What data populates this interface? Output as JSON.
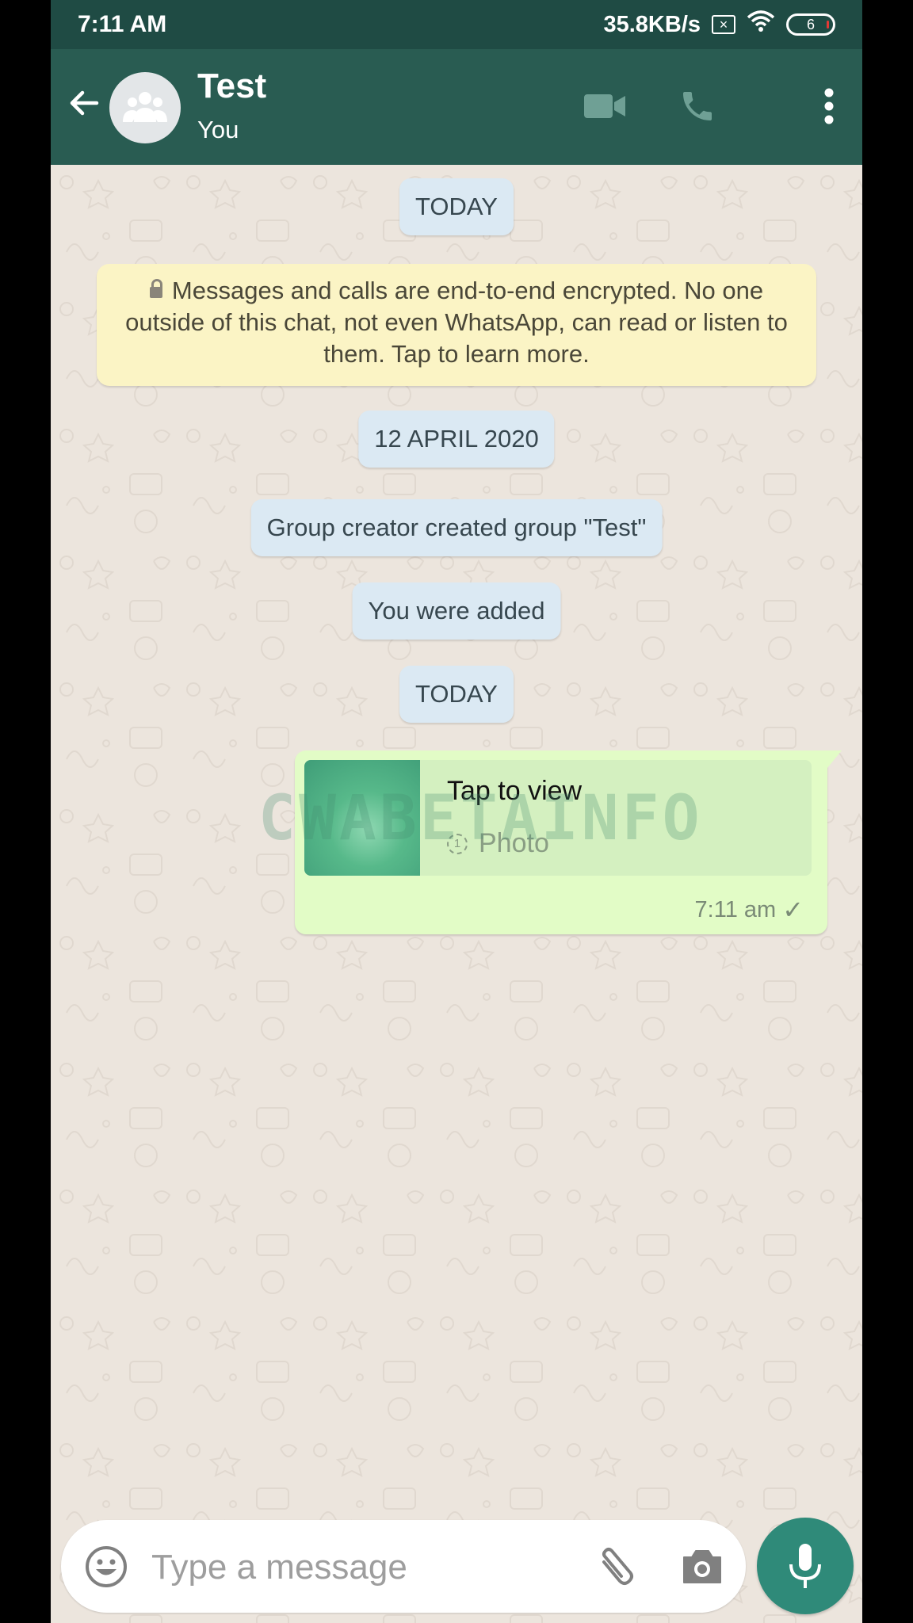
{
  "status_bar": {
    "time": "7:11 AM",
    "network_speed": "35.8KB/s",
    "sim_icon": "sim-x-icon",
    "wifi_icon": "wifi-icon",
    "battery_level": "6"
  },
  "header": {
    "title": "Test",
    "subtitle": "You",
    "back_icon": "arrow-left-icon",
    "avatar_icon": "group-icon",
    "actions": [
      "video-call-icon",
      "voice-call-icon",
      "more-vertical-icon"
    ]
  },
  "chat": {
    "date_today_1": "TODAY",
    "encryption_notice": "Messages and calls are end-to-end encrypted. No one outside of this chat, not even WhatsApp, can read or listen to them. Tap to learn more.",
    "date_group": "12 APRIL 2020",
    "system_created": "Group creator created group \"Test\"",
    "system_added": "You were added",
    "date_today_2": "TODAY",
    "outgoing_message": {
      "title": "Tap to view",
      "type_label": "Photo",
      "view_once_badge": "1",
      "time": "7:11 am",
      "status": "✓"
    },
    "watermark": "CWABETAINFO"
  },
  "composer": {
    "placeholder": "Type a message",
    "value": ""
  },
  "colors": {
    "header": "#295c52",
    "status_bar": "#1f4b44",
    "chat_bg": "#ece5dd",
    "outgoing_bubble": "#e2fcc6",
    "system_pill": "#dbe9f3",
    "encryption_notice": "#fbf4c5",
    "mic_button": "#2f8a79"
  }
}
